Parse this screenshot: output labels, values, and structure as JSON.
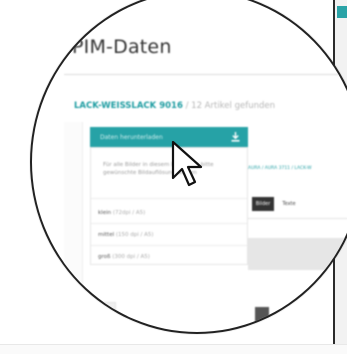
{
  "page_title": "PIM-Daten",
  "product": {
    "name": "LACK-WEISSLACK 9016",
    "separator": "/",
    "count_text": "12 Artikel gefunden"
  },
  "download_dropdown": {
    "button_label": "Daten herunterladen",
    "icon": "download-icon",
    "note": "Für alle Bilder in diesem Datensatz bitte gewünschte Bildauflösung wählen",
    "options": [
      {
        "label": "klein",
        "quality": "(72dpi / A5)"
      },
      {
        "label": "mittel",
        "quality": "(150 dpi / A5)"
      },
      {
        "label": "groß",
        "quality": "(300 dpi / A5)"
      }
    ]
  },
  "breadcrumb": "AURA / AURA 3711 / LACK-W",
  "tabs": [
    {
      "label": "Bilder",
      "active": true
    },
    {
      "label": "Texte",
      "active": false
    }
  ],
  "colors": {
    "accent": "#26a2a6",
    "text": "#333333",
    "muted": "#b6b6b6"
  }
}
